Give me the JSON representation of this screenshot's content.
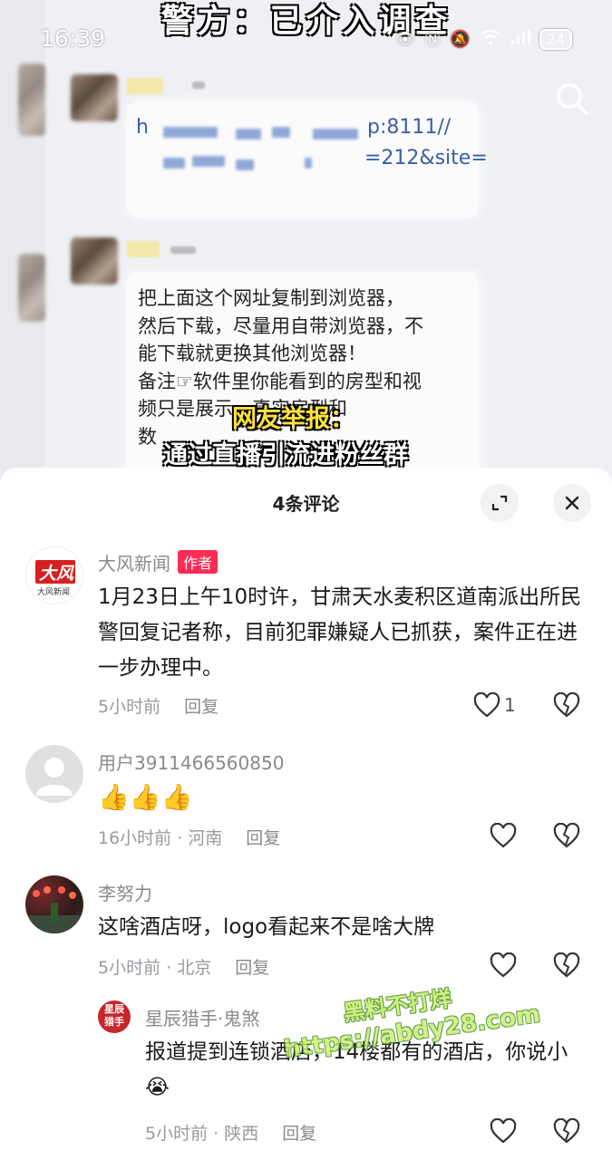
{
  "video": {
    "headline": "警方：已介入调查",
    "status_time": "16:39",
    "battery": "24",
    "url_line1_end": "p:8111//",
    "url_line1_start": "h",
    "url_line2_end": "=212&site=",
    "chat_lines": [
      "把上面这个网址复制到浏览器，",
      "然后下载，尽量用自带浏览器，不",
      "能下载就更换其他浏览器！",
      "备注☞软件里你能看到的房型和视",
      "频只是展示，真实房型和",
      "数"
    ],
    "overlay_yellow": "网友举报：",
    "overlay_white": "通过直播引流进粉丝群"
  },
  "sheet": {
    "title": "4条评论"
  },
  "comments": [
    {
      "name": "大风新闻",
      "author_tag": "作者",
      "avatar_text": "大风",
      "avatar_sub": "大风新闻",
      "text": "1月23日上午10时许，甘肃天水麦积区道南派出所民警回复记者称，目前犯罪嫌疑人已抓获，案件正在进一步办理中。",
      "time": "5小时前",
      "reply": "回复",
      "likes": "1"
    },
    {
      "name": "用户3911466560850",
      "text": "👍👍👍",
      "time": "16小时前 · 河南",
      "reply": "回复"
    },
    {
      "name": "李努力",
      "text": "这啥酒店呀，logo看起来不是啥大牌",
      "time": "5小时前 · 北京",
      "reply": "回复"
    },
    {
      "name": "星辰猎手·鬼煞",
      "avatar_text": "星辰猎手",
      "text": "报道提到连锁酒店，14楼都有的酒店，你说小😭",
      "time": "5小时前 · 陕西",
      "reply": "回复"
    }
  ],
  "watermark": {
    "line1": "黑料不打烊",
    "line2": "https://abdy28.com"
  }
}
